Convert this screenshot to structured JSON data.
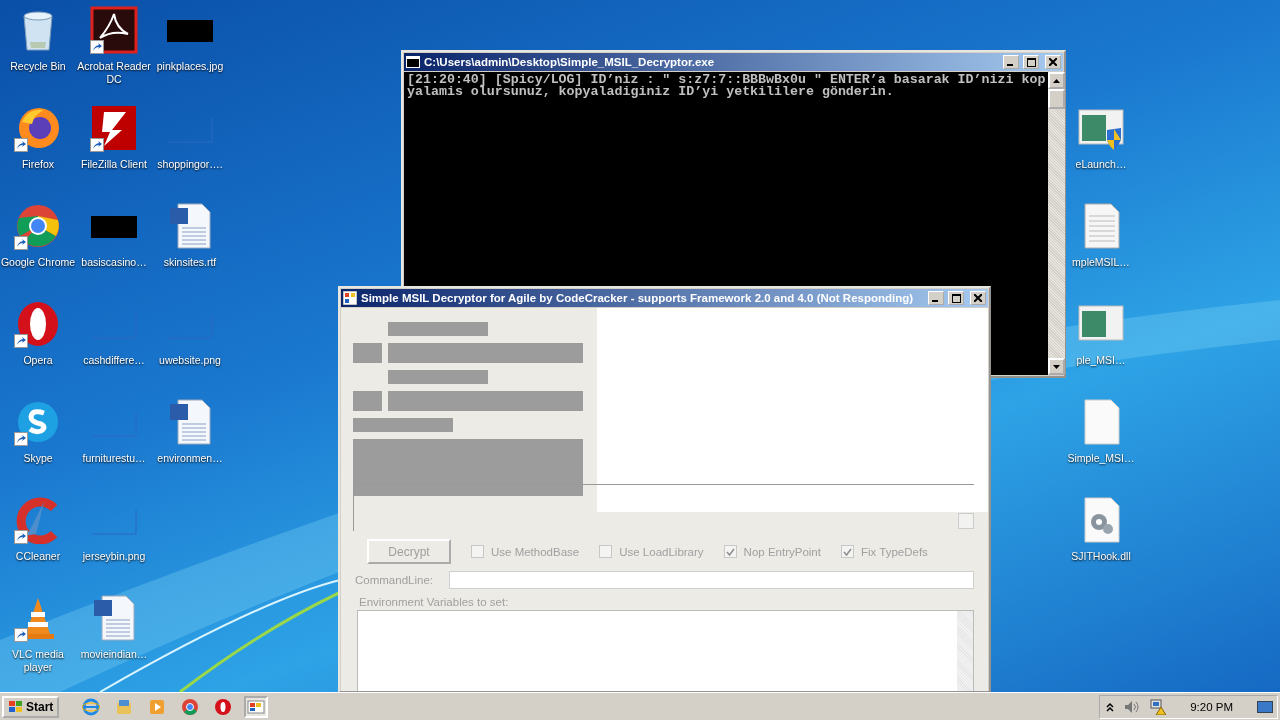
{
  "desktop": {
    "columns": [
      [
        {
          "label": "Recycle Bin",
          "kind": "trash",
          "shortcut": false
        },
        {
          "label": "Firefox",
          "kind": "firefox",
          "shortcut": true
        },
        {
          "label": "Google Chrome",
          "kind": "chrome",
          "shortcut": true
        },
        {
          "label": "Opera",
          "kind": "opera",
          "shortcut": true
        },
        {
          "label": "Skype",
          "kind": "skype",
          "shortcut": true
        },
        {
          "label": "CCleaner",
          "kind": "ccleaner",
          "shortcut": true
        },
        {
          "label": "VLC media player",
          "kind": "vlc",
          "shortcut": true
        }
      ],
      [
        {
          "label": "Acrobat Reader DC",
          "kind": "acrobat",
          "shortcut": true
        },
        {
          "label": "FileZilla Client",
          "kind": "filezilla",
          "shortcut": true
        },
        {
          "label": "basiscasino…",
          "kind": "dark_image",
          "shortcut": false
        },
        {
          "label": "cashdiffere…",
          "kind": "blank_image",
          "shortcut": false
        },
        {
          "label": "furniturestu…",
          "kind": "blank_image",
          "shortcut": false
        },
        {
          "label": "jerseybin.png",
          "kind": "blank_image",
          "shortcut": false
        },
        {
          "label": "movieindian…",
          "kind": "word",
          "shortcut": false
        }
      ],
      [
        {
          "label": "pinkplaces.jpg",
          "kind": "dark_image",
          "shortcut": false
        },
        {
          "label": "shoppingor….",
          "kind": "blank_image",
          "shortcut": false
        },
        {
          "label": "skinsites.rtf",
          "kind": "word",
          "shortcut": false
        },
        {
          "label": "uwebsite.png",
          "kind": "blank_image",
          "shortcut": false
        },
        {
          "label": "environmen…",
          "kind": "word",
          "shortcut": false
        }
      ]
    ],
    "right_column": [
      {
        "label": "eLaunch…",
        "kind": "app_shield",
        "shortcut": false
      },
      {
        "label": "mpleMSIL…",
        "kind": "text_file",
        "shortcut": false
      },
      {
        "label": "ple_MSI…",
        "kind": "app",
        "shortcut": false
      },
      {
        "label": "Simple_MSI…",
        "kind": "blank_file",
        "shortcut": false
      },
      {
        "label": "SJITHook.dll",
        "kind": "dll",
        "shortcut": false
      }
    ]
  },
  "console": {
    "title": "C:\\Users\\admin\\Desktop\\Simple_MSIL_Decryptor.exe",
    "lines": [
      "[21:20:40] [Spicy/LOG] ID’niz : \" s:z7:7::BBBwBx0u \" ENTER’a basarak ID’nizi kop",
      "yalamis olursunuz, kopyaladiginiz ID’yi yetkililere gönderin."
    ]
  },
  "dialog": {
    "title": "Simple MSIL Decryptor for Agile by CodeCracker - supports Framework 2.0 and 4.0 (Not Responding)",
    "decrypt_button": "Decrypt",
    "options": [
      {
        "label": "Use MethodBase",
        "checked": false
      },
      {
        "label": "Use LoadLibrary",
        "checked": false
      },
      {
        "label": "Nop EntryPoint",
        "checked": true
      },
      {
        "label": "Fix TypeDefs",
        "checked": true
      }
    ],
    "command_line_label": "CommandLine:",
    "env_label": "Environment Variables to set:"
  },
  "taskbar": {
    "start": "Start",
    "buttons": [
      {
        "kind": "ie",
        "selected": false
      },
      {
        "kind": "explorer",
        "selected": false
      },
      {
        "kind": "media",
        "selected": false
      },
      {
        "kind": "chrome",
        "selected": false
      },
      {
        "kind": "opera",
        "selected": false
      },
      {
        "kind": "app",
        "selected": true
      }
    ],
    "clock": "9:20 PM"
  }
}
